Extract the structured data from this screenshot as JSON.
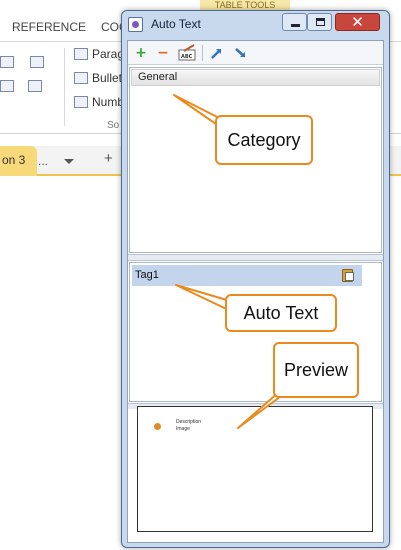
{
  "background": {
    "ribbon_tabs": [
      "REFERENCE",
      "COC"
    ],
    "table_tools": "TABLE TOOLS",
    "ribbon_items": [
      "Paragr",
      "Bullete",
      "Numbe"
    ],
    "group_label": "So",
    "doc_tab": "on 3",
    "doc_tab_more": "...",
    "doc_tab_new": "+"
  },
  "window": {
    "title": "Auto Text",
    "close_glyph": "✕",
    "toolbar": {
      "add_icon": "plus-icon",
      "remove_icon": "minus-icon",
      "spell_icon": "spellcheck-icon",
      "import_icon": "import-arrow-icon",
      "export_icon": "export-arrow-icon"
    },
    "category_header": "General",
    "tag_item": "Tag1",
    "preview_lines": [
      "Description",
      "Image"
    ]
  },
  "callouts": {
    "category": "Category",
    "auto_text": "Auto Text",
    "preview": "Preview"
  },
  "colors": {
    "callout_border": "#e88a1e",
    "selection": "#c2d5ec",
    "close_button": "#c9463d",
    "window_frame": "#c8d9ed"
  }
}
